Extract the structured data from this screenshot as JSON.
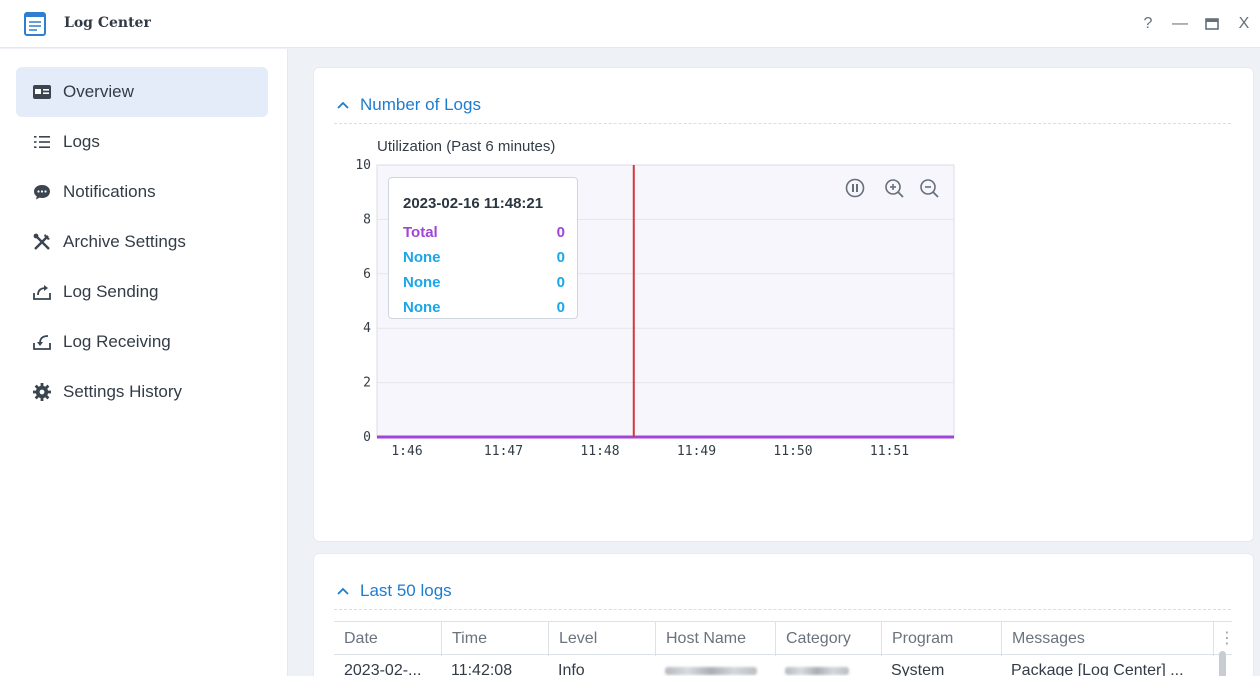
{
  "window": {
    "title": "Log Center",
    "controls": {
      "help": "?",
      "minimize": "—",
      "close": "X"
    }
  },
  "sidebar": {
    "items": [
      {
        "label": "Overview",
        "icon": "overview-icon",
        "active": true
      },
      {
        "label": "Logs",
        "icon": "list-icon"
      },
      {
        "label": "Notifications",
        "icon": "chat-bubble-icon"
      },
      {
        "label": "Archive Settings",
        "icon": "tools-icon"
      },
      {
        "label": "Log Sending",
        "icon": "upload-icon"
      },
      {
        "label": "Log Receiving",
        "icon": "download-icon"
      },
      {
        "label": "Settings History",
        "icon": "gear-icon"
      }
    ]
  },
  "number_of_logs": {
    "title": "Number of Logs",
    "chart_title": "Utilization (Past 6 minutes)",
    "tooltip": {
      "time": "2023-02-16 11:48:21",
      "rows": [
        {
          "label": "Total",
          "value": "0",
          "color": "#a045d8"
        },
        {
          "label": "None",
          "value": "0",
          "color": "#1aa6e8"
        },
        {
          "label": "None",
          "value": "0",
          "color": "#1aa6e8"
        },
        {
          "label": "None",
          "value": "0",
          "color": "#1aa6e8"
        }
      ]
    }
  },
  "chart_data": {
    "type": "line",
    "title": "Utilization (Past 6 minutes)",
    "xlabel": "",
    "ylabel": "",
    "x": [
      "1:46",
      "11:47",
      "11:48",
      "11:49",
      "11:50",
      "11:51"
    ],
    "ylim": [
      0,
      10
    ],
    "yticks": [
      0,
      2,
      4,
      6,
      8,
      10
    ],
    "cursor_time": "11:48:21",
    "series": [
      {
        "name": "Total",
        "values": [
          0,
          0,
          0,
          0,
          0,
          0
        ],
        "color": "#a045d8"
      },
      {
        "name": "None",
        "values": [
          0,
          0,
          0,
          0,
          0,
          0
        ],
        "color": "#1aa6e8"
      }
    ],
    "grid": true
  },
  "last_logs": {
    "title": "Last 50 logs",
    "columns": [
      "Date",
      "Time",
      "Level",
      "Host Name",
      "Category",
      "Program",
      "Messages"
    ],
    "rows": [
      {
        "date": "2023-02-...",
        "time": "11:42:08",
        "level": "Info",
        "program": "System",
        "message": "Package [Log Center] ..."
      }
    ]
  }
}
